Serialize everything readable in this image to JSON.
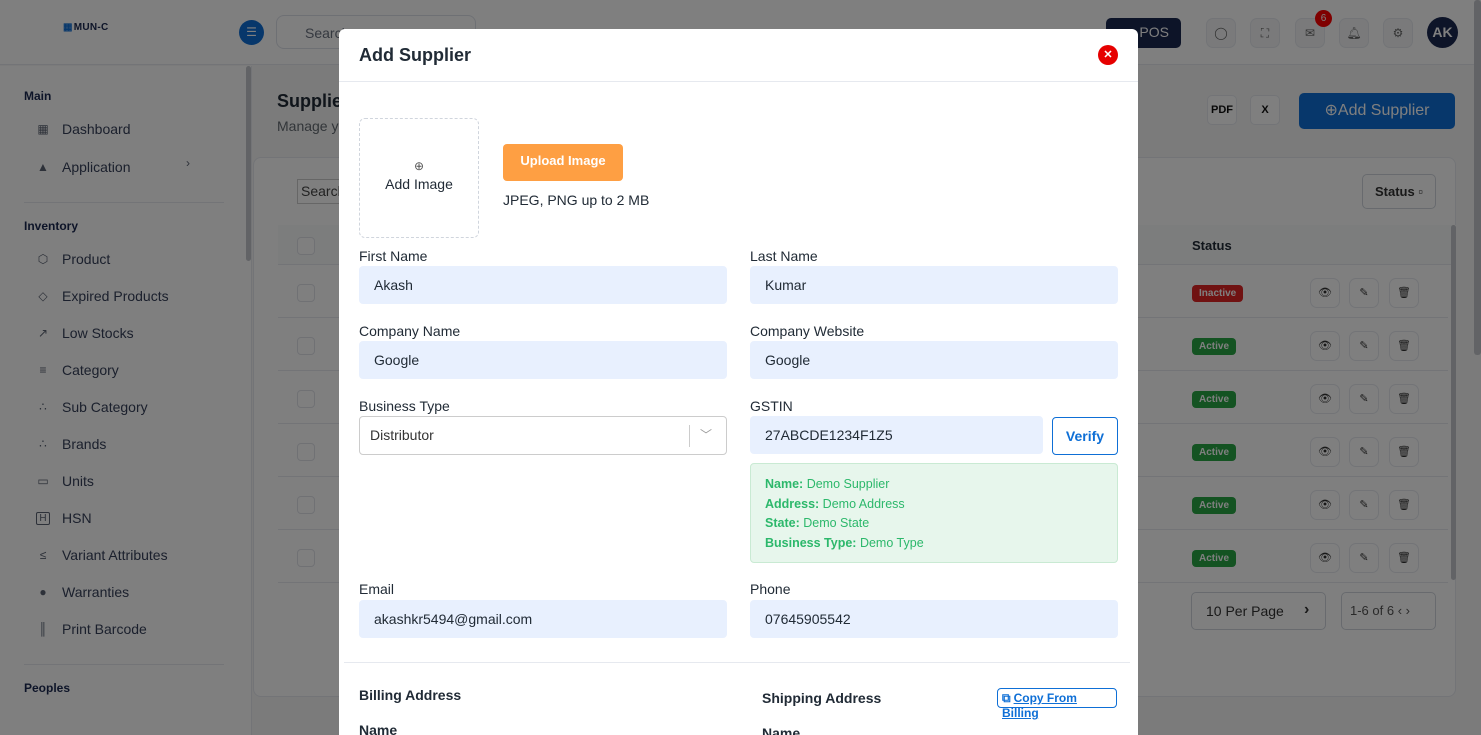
{
  "header": {
    "logo": "MUN-C",
    "logo_mark": "▦",
    "search_placeholder": "Search",
    "pos_label": "POS",
    "mail_count": "6",
    "avatar": "AK"
  },
  "sidebar": {
    "sections": [
      {
        "title": "Main",
        "items": [
          {
            "label": "Dashboard",
            "icon": "dashboard-icon",
            "glyph": "▦"
          },
          {
            "label": "Application",
            "icon": "app-icon",
            "glyph": "▲"
          }
        ]
      },
      {
        "title": "Inventory",
        "items": [
          {
            "label": "Product",
            "icon": "box-icon",
            "glyph": "⬡"
          },
          {
            "label": "Expired Products",
            "icon": "expired-icon",
            "glyph": "◇"
          },
          {
            "label": "Low Stocks",
            "icon": "trend-down-icon",
            "glyph": "↗"
          },
          {
            "label": "Category",
            "icon": "category-icon",
            "glyph": "≡"
          },
          {
            "label": "Sub Category",
            "icon": "subcategory-icon",
            "glyph": "∴"
          },
          {
            "label": "Brands",
            "icon": "brands-icon",
            "glyph": "∴"
          },
          {
            "label": "Units",
            "icon": "units-icon",
            "glyph": "▭"
          },
          {
            "label": "HSN",
            "icon": "hsn-icon",
            "glyph": "H"
          },
          {
            "label": "Variant Attributes",
            "icon": "variant-icon",
            "glyph": "≤"
          },
          {
            "label": "Warranties",
            "icon": "warranty-icon",
            "glyph": "●"
          },
          {
            "label": "Print Barcode",
            "icon": "barcode-icon",
            "glyph": "║"
          }
        ]
      },
      {
        "title": "Peoples",
        "items": []
      }
    ]
  },
  "page": {
    "title": "Supplie",
    "subtitle": "Manage y",
    "add_button": "⊕Add Supplier",
    "search_placeholder": "Search",
    "status_filter": "Status ▫",
    "status_header": "Status",
    "rows": [
      {
        "status": "Inactive",
        "kind": "inactive"
      },
      {
        "status": "Active",
        "kind": "active"
      },
      {
        "status": "Active",
        "kind": "active"
      },
      {
        "status": "Active",
        "kind": "active"
      },
      {
        "status": "Active",
        "kind": "active"
      },
      {
        "status": "Active",
        "kind": "active"
      }
    ],
    "per_page": "10 Per Page",
    "pagination": "1-6 of 6 ‹  ›"
  },
  "modal": {
    "title": "Add Supplier",
    "add_image": "Add Image",
    "upload_button": "Upload Image",
    "upload_note": "JPEG, PNG up to 2 MB",
    "first_name_label": "First Name",
    "first_name": "Akash",
    "last_name_label": "Last Name",
    "last_name": "Kumar",
    "company_name_label": "Company Name",
    "company_name": "Google",
    "company_website_label": "Company Website",
    "company_website": "Google",
    "business_type_label": "Business Type",
    "business_type": "Distributor",
    "gstin_label": "GSTIN",
    "gstin": "27ABCDE1234F1Z5",
    "verify_button": "Verify",
    "gst_info": {
      "name_label": "Name:",
      "name": "Demo Supplier",
      "address_label": "Address:",
      "address": "Demo Address",
      "state_label": "State:",
      "state": "Demo State",
      "business_type_label": "Business Type:",
      "business_type": "Demo Type"
    },
    "email_label": "Email",
    "email": "akashkr5494@gmail.com",
    "phone_label": "Phone",
    "phone": "07645905542",
    "billing_title": "Billing Address",
    "shipping_title": "Shipping Address",
    "copy_button": "Copy From Billing",
    "billing_name_label": "Name",
    "shipping_name_label": "Name"
  },
  "colors": {
    "primary": "#0e6fd6",
    "navy": "#1b2850",
    "orange": "#fe9f43",
    "success": "#28a745",
    "danger": "#e02424"
  }
}
